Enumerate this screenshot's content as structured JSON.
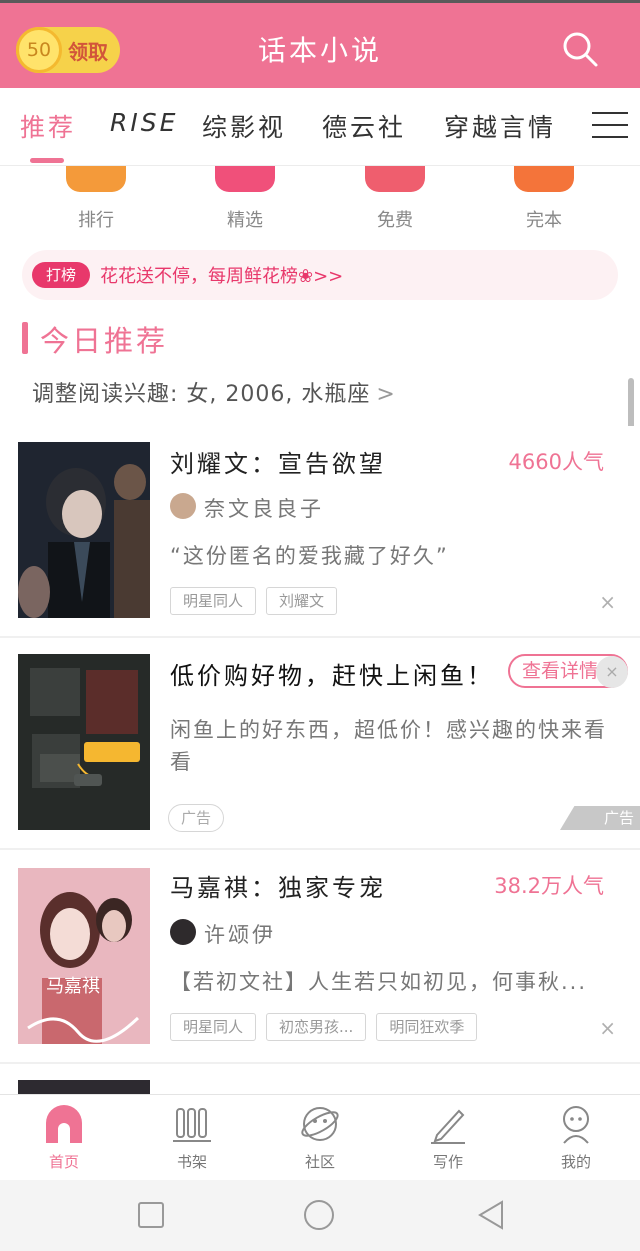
{
  "header": {
    "coin_amount": "50",
    "coin_label": "领取",
    "title": "话本小说",
    "search_icon": "search-icon"
  },
  "tabs": [
    {
      "label": "推荐",
      "active": true
    },
    {
      "label": "RISE"
    },
    {
      "label": "综影视"
    },
    {
      "label": "德云社"
    },
    {
      "label": "穿越言情"
    }
  ],
  "quick_entries": [
    {
      "label": "排行",
      "icon": "rank-icon",
      "color": "#f49a3a"
    },
    {
      "label": "精选",
      "icon": "featured-icon",
      "color": "#f0507a"
    },
    {
      "label": "免费",
      "icon": "free-icon",
      "color": "#ef5e6e"
    },
    {
      "label": "完本",
      "icon": "complete-icon",
      "color": "#f4743a"
    }
  ],
  "banner": {
    "badge": "打榜",
    "text": "花花送不停，每周鲜花榜❀>>"
  },
  "section": {
    "title": "今日推荐",
    "interest": "调整阅读兴趣: 女, 2006, 水瓶座",
    "chevron": ">"
  },
  "books": [
    {
      "title": "刘耀文：宣告欲望",
      "popularity": "4660人气",
      "author": "奈文良良子",
      "description": "“这份匿名的爱我藏了好久”",
      "tags": [
        "明星同人",
        "刘耀文"
      ],
      "close": "×"
    },
    {
      "title": "马嘉祺：独家专宠",
      "popularity": "38.2万人气",
      "author": "许颂伊",
      "description": "【若初文社】人生若只如初见，何事秋...",
      "tags": [
        "明星同人",
        "初恋男孩...",
        "明同狂欢季"
      ],
      "close": "×",
      "cover_text": "马嘉祺"
    }
  ],
  "ad": {
    "title": "低价购好物，赶快上闲鱼！",
    "button": "查看详情",
    "description": "闲鱼上的好东西，超低价！感兴趣的快来看看",
    "tag": "广告",
    "mark": "广告",
    "close": "×"
  },
  "bottom_nav": [
    {
      "label": "首页",
      "icon": "home-icon",
      "active": true
    },
    {
      "label": "书架",
      "icon": "bookshelf-icon"
    },
    {
      "label": "社区",
      "icon": "community-icon"
    },
    {
      "label": "写作",
      "icon": "pen-icon"
    },
    {
      "label": "我的",
      "icon": "profile-icon"
    }
  ],
  "system_nav": [
    "square-icon",
    "circle-icon",
    "back-triangle-icon"
  ],
  "colors": {
    "brand": "#ef7394",
    "banner_red": "#e8386b",
    "coin": "#f6d24a"
  }
}
